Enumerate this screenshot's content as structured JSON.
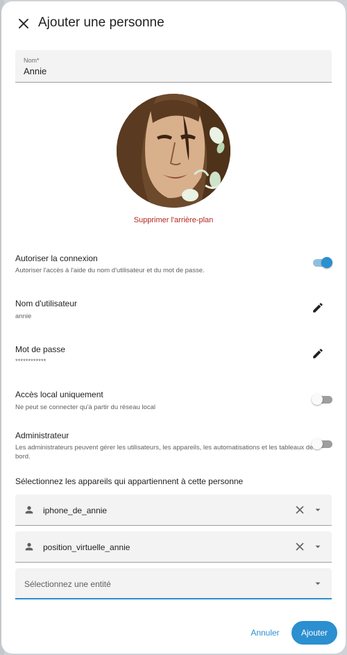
{
  "dialog": {
    "title": "Ajouter une personne",
    "close_icon": "close-icon"
  },
  "name_field": {
    "label": "Nom*",
    "value": "Annie"
  },
  "avatar": {
    "remove_background_label": "Supprimer l'arrière-plan"
  },
  "settings": {
    "allow_login": {
      "title": "Autoriser la connexion",
      "subtitle": "Autoriser l'accès à l'aide du nom d'utilisateur et du mot de passe.",
      "enabled": true
    },
    "username": {
      "title": "Nom d'utilisateur",
      "value": "annie",
      "icon": "pencil-icon"
    },
    "password": {
      "title": "Mot de passe",
      "value": "************",
      "icon": "pencil-icon"
    },
    "local_only": {
      "title": "Accès local uniquement",
      "subtitle": "Ne peut se connecter qu'à partir du réseau local",
      "enabled": false
    },
    "admin": {
      "title": "Administrateur",
      "subtitle": "Les administrateurs peuvent gérer les utilisateurs, les appareils, les automatisations et les tableaux de bord.",
      "enabled": false
    }
  },
  "devices": {
    "heading": "Sélectionnez les appareils qui appartiennent à cette personne",
    "items": [
      {
        "name": "iphone_de_annie"
      },
      {
        "name": "position_virtuelle_annie"
      }
    ],
    "entity_placeholder": "Sélectionnez une entité"
  },
  "actions": {
    "cancel": "Annuler",
    "add": "Ajouter"
  },
  "colors": {
    "primary": "#2b8fd0",
    "danger": "#b3261e"
  }
}
